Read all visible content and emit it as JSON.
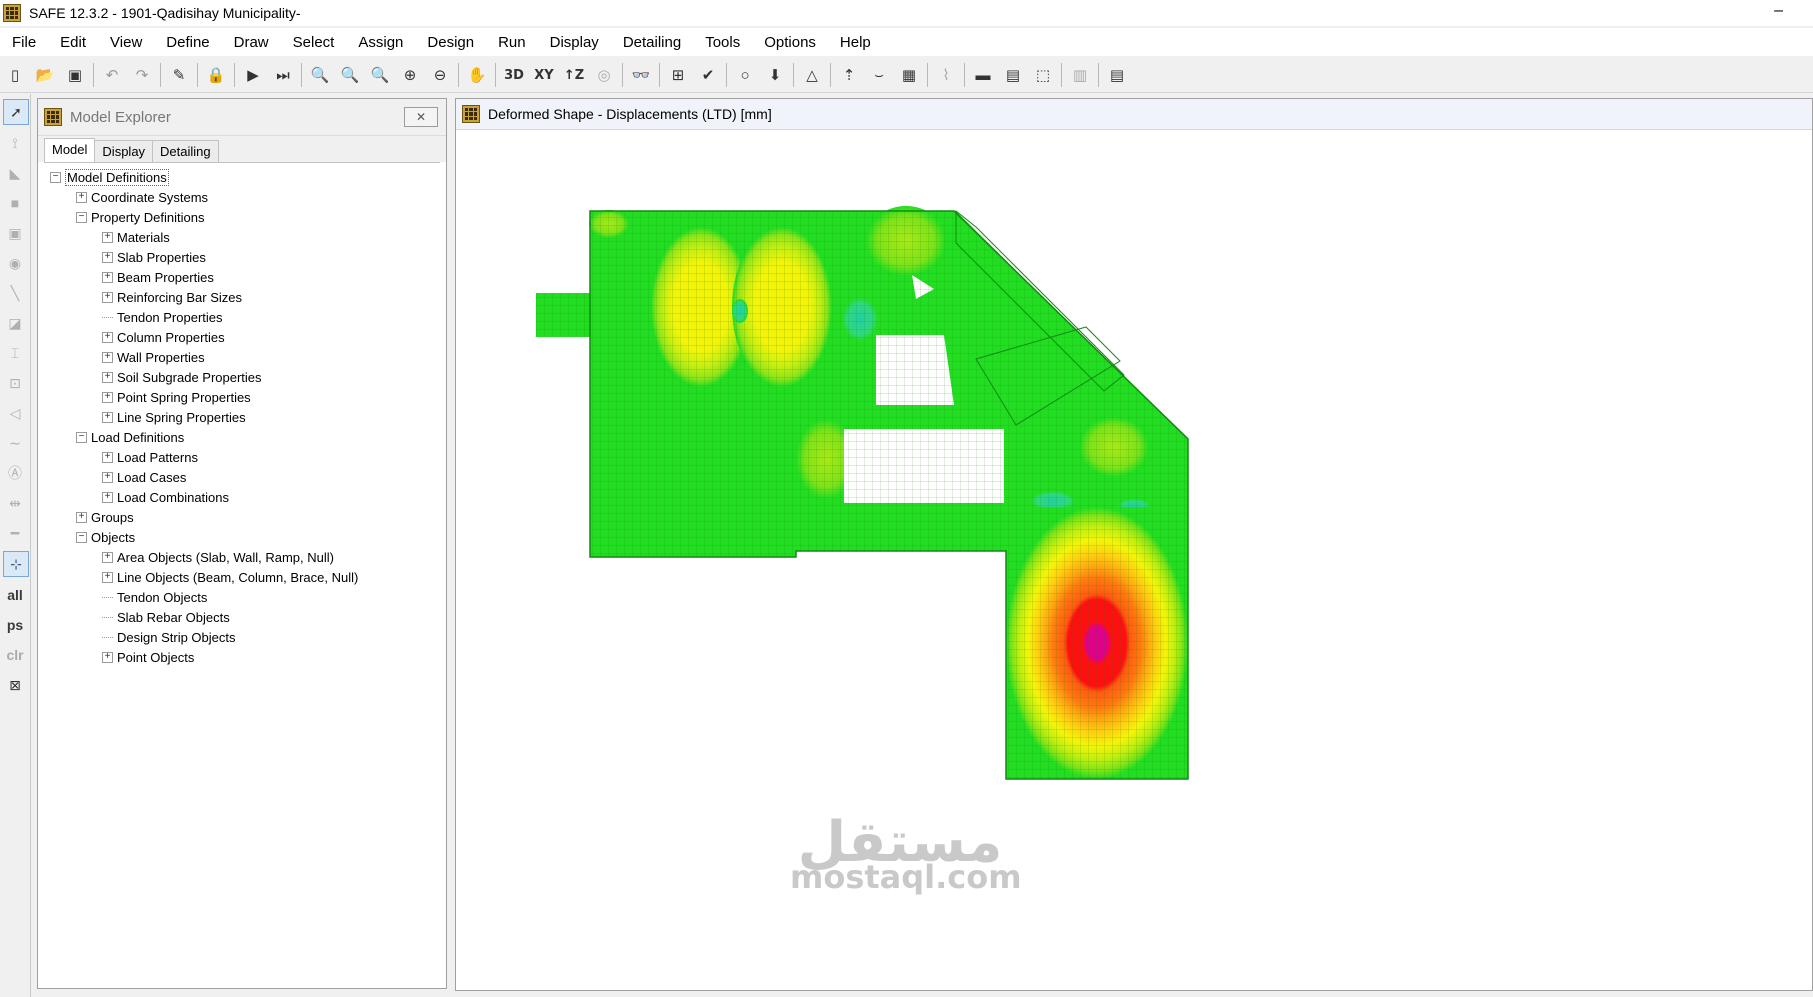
{
  "window": {
    "title": "SAFE 12.3.2 - 1901-Qadisihay Municipality-",
    "minimize": "–"
  },
  "menu": [
    "File",
    "Edit",
    "View",
    "Define",
    "Draw",
    "Select",
    "Assign",
    "Design",
    "Run",
    "Display",
    "Detailing",
    "Tools",
    "Options",
    "Help"
  ],
  "toolbar": {
    "labels": [
      "3D",
      "XY",
      "↑Z"
    ]
  },
  "lefttools": {
    "labels": [
      "all",
      "ps",
      "clr"
    ]
  },
  "explorer": {
    "title": "Model Explorer",
    "tabs": [
      "Model",
      "Display",
      "Detailing"
    ],
    "tree": [
      {
        "label": "Model Definitions",
        "level": 0,
        "exp": "−"
      },
      {
        "label": "Coordinate Systems",
        "level": 1,
        "exp": "+"
      },
      {
        "label": "Property Definitions",
        "level": 1,
        "exp": "−"
      },
      {
        "label": "Materials",
        "level": 2,
        "exp": "+"
      },
      {
        "label": "Slab Properties",
        "level": 2,
        "exp": "+"
      },
      {
        "label": "Beam Properties",
        "level": 2,
        "exp": "+"
      },
      {
        "label": "Reinforcing Bar Sizes",
        "level": 2,
        "exp": "+"
      },
      {
        "label": "Tendon Properties",
        "level": 2,
        "exp": ""
      },
      {
        "label": "Column Properties",
        "level": 2,
        "exp": "+"
      },
      {
        "label": "Wall Properties",
        "level": 2,
        "exp": "+"
      },
      {
        "label": "Soil Subgrade Properties",
        "level": 2,
        "exp": "+"
      },
      {
        "label": "Point Spring Properties",
        "level": 2,
        "exp": "+"
      },
      {
        "label": "Line Spring Properties",
        "level": 2,
        "exp": "+"
      },
      {
        "label": "Load Definitions",
        "level": 1,
        "exp": "−"
      },
      {
        "label": "Load Patterns",
        "level": 2,
        "exp": "+"
      },
      {
        "label": "Load Cases",
        "level": 2,
        "exp": "+"
      },
      {
        "label": "Load Combinations",
        "level": 2,
        "exp": "+"
      },
      {
        "label": "Groups",
        "level": 1,
        "exp": "+"
      },
      {
        "label": "Objects",
        "level": 1,
        "exp": "−"
      },
      {
        "label": "Area Objects (Slab, Wall, Ramp, Null)",
        "level": 2,
        "exp": "+"
      },
      {
        "label": "Line Objects (Beam, Column, Brace, Null)",
        "level": 2,
        "exp": "+"
      },
      {
        "label": "Tendon Objects",
        "level": 2,
        "exp": ""
      },
      {
        "label": "Slab Rebar Objects",
        "level": 2,
        "exp": ""
      },
      {
        "label": "Design Strip Objects",
        "level": 2,
        "exp": ""
      },
      {
        "label": "Point Objects",
        "level": 2,
        "exp": "+"
      }
    ]
  },
  "viewport": {
    "title": "Deformed Shape - Displacements (LTD)  [mm]"
  },
  "watermark": {
    "arabic": "مستقل",
    "latin": "mostaql.com"
  },
  "colors": {
    "slab": "#22dd22",
    "yellow": "#f2f20a",
    "orange": "#ff9900",
    "red": "#ff1a1a",
    "magenta": "#e6007a",
    "cyan": "#20d0a0"
  }
}
